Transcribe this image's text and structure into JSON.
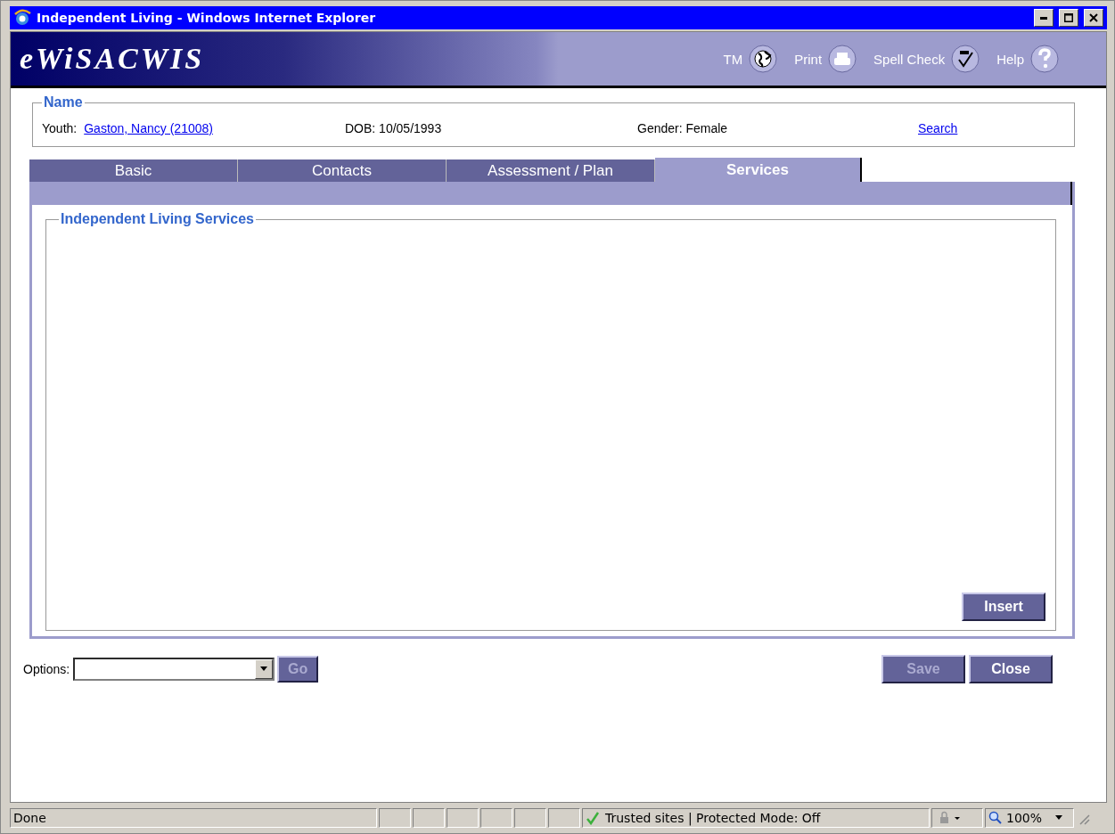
{
  "window": {
    "title": "Independent Living - Windows Internet Explorer"
  },
  "banner": {
    "logo": "eWiSACWIS",
    "tools": [
      {
        "label": "TM",
        "kind": "globe"
      },
      {
        "label": "Print",
        "kind": "printer"
      },
      {
        "label": "Spell Check",
        "kind": "spell"
      },
      {
        "label": "Help",
        "kind": "help"
      }
    ]
  },
  "name_section": {
    "legend": "Name",
    "youth_label": "Youth:",
    "youth_link": "Gaston, Nancy (21008)",
    "dob": "DOB: 10/05/1993",
    "gender": "Gender: Female",
    "search_link": "Search"
  },
  "tabs": [
    {
      "label": "Basic",
      "selected": false
    },
    {
      "label": "Contacts",
      "selected": false
    },
    {
      "label": "Assessment / Plan",
      "selected": false
    },
    {
      "label": "Services",
      "selected": true
    }
  ],
  "services_section": {
    "legend": "Independent Living Services",
    "buttons": [
      {
        "label": "Insert",
        "disabled": false
      }
    ]
  },
  "options": {
    "label": "Options:",
    "go_button": {
      "label": "Go",
      "disabled": true
    }
  },
  "buttons": [
    {
      "label": "Save",
      "disabled": true
    },
    {
      "label": "Close",
      "disabled": false
    }
  ],
  "status_bar": {
    "text": "Done",
    "zone": "Trusted sites | Protected Mode: Off",
    "zoom": "100%"
  }
}
